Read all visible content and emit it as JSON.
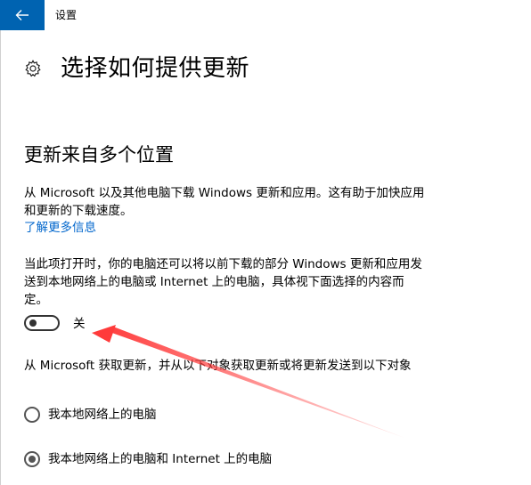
{
  "window": {
    "title": "设置",
    "accent_color": "#0063b1"
  },
  "icons": {
    "back": "back-arrow-icon",
    "page": "gear-icon"
  },
  "page": {
    "title": "选择如何提供更新"
  },
  "section": {
    "title": "更新来自多个位置",
    "description": "从 Microsoft 以及其他电脑下载 Windows 更新和应用。这有助于加快应用和更新的下载速度。",
    "link": "了解更多信息",
    "toggle_description": "当此项打开时，你的电脑还可以将以前下载的部分 Windows 更新和应用发送到本地网络上的电脑或 Internet 上的电脑，具体视下面选择的内容而定。",
    "toggle": {
      "state_label": "关",
      "on": false
    },
    "options_description": "从 Microsoft 获取更新，并从以下对象获取更新或将更新发送到以下对象",
    "options": [
      {
        "label": "我本地网络上的电脑",
        "selected": false
      },
      {
        "label": "我本地网络上的电脑和 Internet 上的电脑",
        "selected": true
      }
    ]
  },
  "annotation": {
    "arrow_color": "#ff3b3b"
  }
}
